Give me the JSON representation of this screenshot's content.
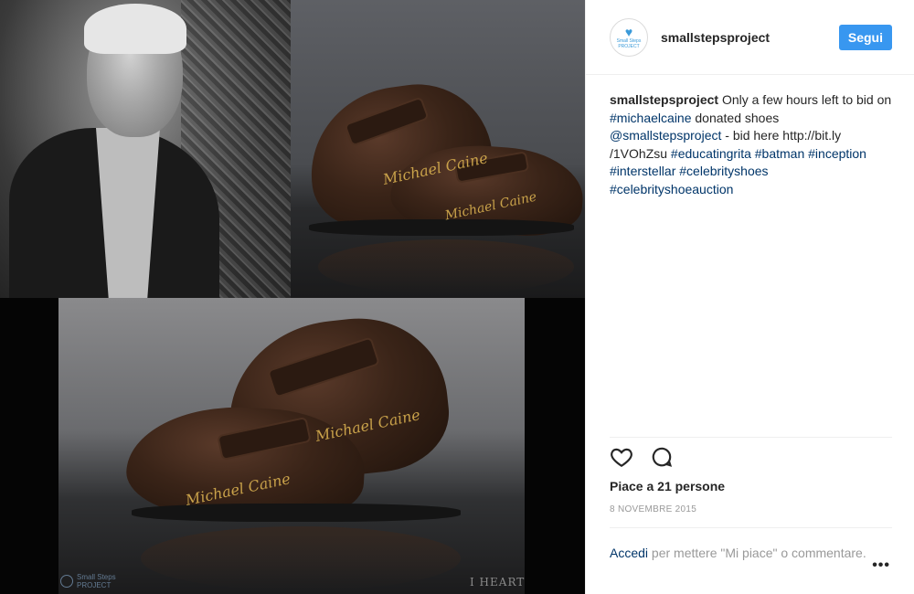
{
  "post": {
    "username": "smallstepsproject",
    "follow_label": "Segui",
    "avatar": {
      "brand_line1": "Small Steps",
      "brand_line2": "PROJECT",
      "icon": "heart-icon"
    },
    "caption": {
      "author": "smallstepsproject",
      "t1": " Only a few hours left to bid on ",
      "tag1": "#michaelcaine",
      "t2": " donated shoes ",
      "tag2": "@smallstepsproject",
      "t3": " - bid here http://bit.ly /1VOhZsu ",
      "tag3": "#educatingrita",
      "t4": " ",
      "tag4": "#batman",
      "t5": " ",
      "tag5": "#inception",
      "t6": " ",
      "tag6": "#interstellar",
      "t7": " ",
      "tag7": "#celebrityshoes",
      "t8": " ",
      "tag8": "#celebrityshoeauction"
    },
    "likes": "Piace a 21 persone",
    "date": "8 NOVEMBRE 2015",
    "comment": {
      "login": "Accedi",
      "rest": " per mettere \"Mi piace\" o commentare."
    },
    "more_label": "•••",
    "icons": {
      "like": "heart-icon",
      "comment": "comment-icon"
    },
    "colors": {
      "follow_bg": "#3897f0",
      "link": "#003569"
    }
  },
  "image": {
    "signature": "Michael Caine",
    "watermark_logo_line1": "Small Steps",
    "watermark_logo_line2": "PROJECT",
    "watermark_right": "I HEART"
  }
}
